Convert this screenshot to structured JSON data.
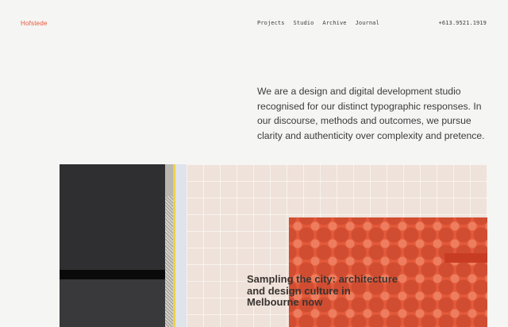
{
  "header": {
    "logo": "Hofstede",
    "nav": [
      "Projects",
      "Studio",
      "Archive",
      "Journal"
    ],
    "phone": "+613.9521.1919"
  },
  "intro": "We are a design and digital development studio recognised for our distinct typographic responses. In our discourse, methods and outcomes, we pursue clarity and authenticity over complexity and pretence.",
  "feature": {
    "caption": "Sampling the city: architecture and design culture in Melbourne now"
  },
  "colors": {
    "accent": "#e8563a",
    "background": "#f5f5f4",
    "text": "#3b3b3b"
  }
}
